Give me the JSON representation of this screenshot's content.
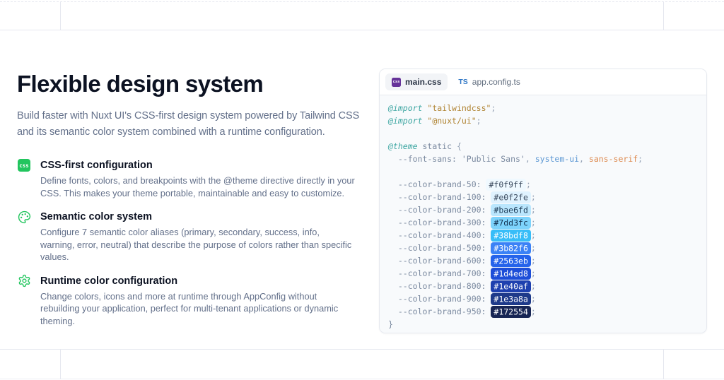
{
  "colors": {
    "accent-green": "#22c55e",
    "css-purple": "#663399",
    "ts-blue": "#3178c6",
    "grid-line": "#e5e7ef",
    "panel-border": "#e6e9ef",
    "code-bg": "#f8fafc",
    "heading": "#0c1222",
    "body-gray": "#63708a"
  },
  "hero": {
    "title": "Flexible design system",
    "subtitle": "Build faster with Nuxt UI's CSS-first design system powered by Tailwind CSS and its semantic color system combined with a runtime configuration.",
    "features": [
      {
        "icon": "css-file-icon",
        "icon_label": "css",
        "title": "CSS-first configuration",
        "description": "Define fonts, colors, and breakpoints with the @theme directive directly in your CSS. This makes your theme portable, maintainable and easy to customize."
      },
      {
        "icon": "palette-icon",
        "title": "Semantic color system",
        "description": "Configure 7 semantic color aliases (primary, secondary, success, info, warning, error, neutral) that describe the purpose of colors rather than specific values."
      },
      {
        "icon": "gear-icon",
        "title": "Runtime color configuration",
        "description": "Change colors, icons and more at runtime through AppConfig without rebuilding your application, perfect for multi-tenant applications or dynamic theming."
      }
    ]
  },
  "code_panel": {
    "tabs": [
      {
        "label": "main.css",
        "icon": "css-file-icon",
        "icon_label": "css",
        "active": true
      },
      {
        "label": "app.config.ts",
        "icon": "typescript-icon",
        "icon_label": "TS",
        "active": false
      }
    ],
    "lines": [
      [
        {
          "t": "kw",
          "v": "@import"
        },
        {
          "t": "def",
          "v": " "
        },
        {
          "t": "str",
          "v": "\"tailwindcss\""
        },
        {
          "t": "pun",
          "v": ";"
        }
      ],
      [
        {
          "t": "kw",
          "v": "@import"
        },
        {
          "t": "def",
          "v": " "
        },
        {
          "t": "str",
          "v": "\"@nuxt/ui\""
        },
        {
          "t": "pun",
          "v": ";"
        }
      ],
      [],
      [
        {
          "t": "kw",
          "v": "@theme"
        },
        {
          "t": "def",
          "v": " static "
        },
        {
          "t": "pun",
          "v": "{"
        }
      ],
      [
        {
          "t": "def",
          "v": "  --font-sans: 'Public Sans'"
        },
        {
          "t": "pun",
          "v": ", "
        },
        {
          "t": "blue",
          "v": "system-ui"
        },
        {
          "t": "pun",
          "v": ", "
        },
        {
          "t": "orange",
          "v": "sans-serif"
        },
        {
          "t": "pun",
          "v": ";"
        }
      ],
      [],
      [
        {
          "t": "def",
          "v": "  --color-brand-50: "
        },
        {
          "t": "chip",
          "v": "#f0f9ff",
          "tc": "#3b4a5e"
        },
        {
          "t": "pun",
          "v": ";"
        }
      ],
      [
        {
          "t": "def",
          "v": "  --color-brand-100: "
        },
        {
          "t": "chip",
          "v": "#e0f2fe",
          "tc": "#3b4a5e"
        },
        {
          "t": "pun",
          "v": ";"
        }
      ],
      [
        {
          "t": "def",
          "v": "  --color-brand-200: "
        },
        {
          "t": "chip",
          "v": "#bae6fd",
          "tc": "#1d3b57"
        },
        {
          "t": "pun",
          "v": ";"
        }
      ],
      [
        {
          "t": "def",
          "v": "  --color-brand-300: "
        },
        {
          "t": "chip",
          "v": "#7dd3fc",
          "tc": "#123150"
        },
        {
          "t": "pun",
          "v": ";"
        }
      ],
      [
        {
          "t": "def",
          "v": "  --color-brand-400: "
        },
        {
          "t": "chip",
          "v": "#38bdf8",
          "tc": "#ffffff"
        },
        {
          "t": "pun",
          "v": ";"
        }
      ],
      [
        {
          "t": "def",
          "v": "  --color-brand-500: "
        },
        {
          "t": "chip",
          "v": "#3b82f6",
          "tc": "#ffffff"
        },
        {
          "t": "pun",
          "v": ";"
        }
      ],
      [
        {
          "t": "def",
          "v": "  --color-brand-600: "
        },
        {
          "t": "chip",
          "v": "#2563eb",
          "tc": "#ffffff"
        },
        {
          "t": "pun",
          "v": ";"
        }
      ],
      [
        {
          "t": "def",
          "v": "  --color-brand-700: "
        },
        {
          "t": "chip",
          "v": "#1d4ed8",
          "tc": "#ffffff"
        },
        {
          "t": "pun",
          "v": ";"
        }
      ],
      [
        {
          "t": "def",
          "v": "  --color-brand-800: "
        },
        {
          "t": "chip",
          "v": "#1e40af",
          "tc": "#ffffff"
        },
        {
          "t": "pun",
          "v": ";"
        }
      ],
      [
        {
          "t": "def",
          "v": "  --color-brand-900: "
        },
        {
          "t": "chip",
          "v": "#1e3a8a",
          "tc": "#ffffff"
        },
        {
          "t": "pun",
          "v": ";"
        }
      ],
      [
        {
          "t": "def",
          "v": "  --color-brand-950: "
        },
        {
          "t": "chip",
          "v": "#172554",
          "tc": "#ffffff"
        },
        {
          "t": "pun",
          "v": ";"
        }
      ],
      [
        {
          "t": "def",
          "v": "}"
        }
      ]
    ]
  }
}
